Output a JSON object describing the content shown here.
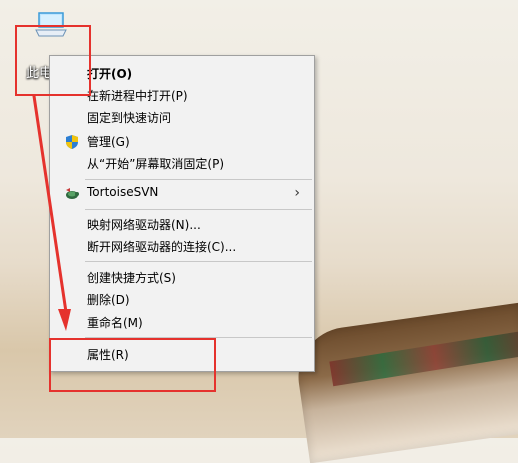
{
  "desktop": {
    "icon_label": "此电"
  },
  "menu": {
    "items": [
      {
        "label": "打开(O)",
        "bold": true
      },
      {
        "label": "在新进程中打开(P)"
      },
      {
        "label": "固定到快速访问"
      },
      {
        "label": "管理(G)",
        "icon": "shield-icon"
      },
      {
        "label": "从“开始”屏幕取消固定(P)"
      },
      {
        "label": "TortoiseSVN",
        "icon": "tortoisesvn-icon",
        "submenu": "›"
      },
      {
        "label": "映射网络驱动器(N)..."
      },
      {
        "label": "断开网络驱动器的连接(C)..."
      },
      {
        "label": "创建快捷方式(S)"
      },
      {
        "label": "删除(D)"
      },
      {
        "label": "重命名(M)"
      },
      {
        "label": "属性(R)"
      }
    ]
  },
  "annotations": {
    "highlight_color": "#e5322d"
  },
  "icons": [
    "computer-icon",
    "shield-icon",
    "tortoisesvn-icon",
    "chevron-right-icon",
    "arrow-down-icon"
  ]
}
